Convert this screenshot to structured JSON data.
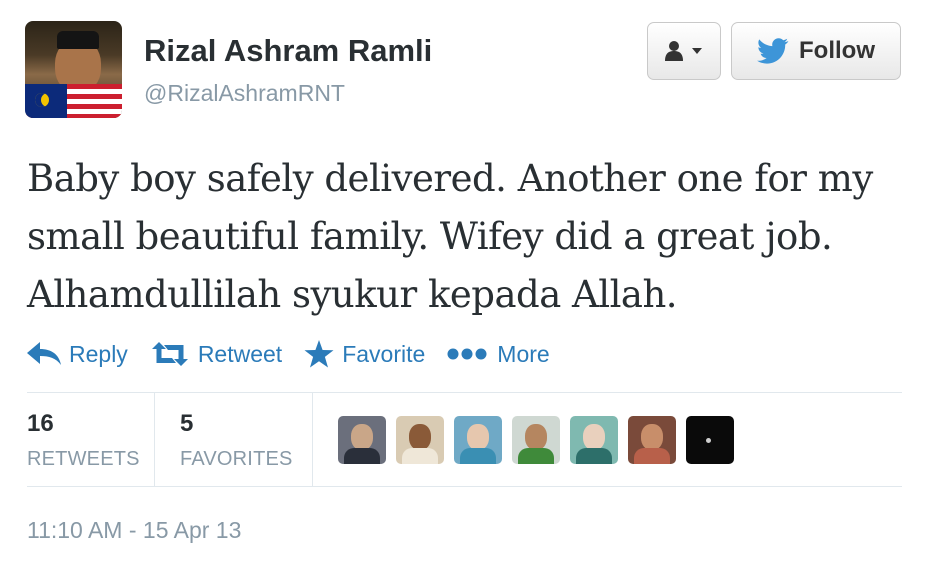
{
  "author": {
    "name": "Rizal Ashram Ramli",
    "handle": "@RizalAshramRNT"
  },
  "buttons": {
    "follow_label": "Follow"
  },
  "tweet": {
    "text": "Baby boy safely delivered. Another one for my small beautiful family. Wifey did a great job. Alhamdullilah syukur kepada Allah."
  },
  "actions": [
    {
      "label": "Reply",
      "icon": "reply-icon"
    },
    {
      "label": "Retweet",
      "icon": "retweet-icon"
    },
    {
      "label": "Favorite",
      "icon": "star-icon"
    },
    {
      "label": "More",
      "icon": "more-dots-icon"
    }
  ],
  "stats": {
    "retweets": {
      "count": "16",
      "label": "RETWEETS"
    },
    "favorites": {
      "count": "5",
      "label": "FAVORITES"
    }
  },
  "favoriters_count_shown": 7,
  "timestamp": "11:10 AM - 15 Apr 13",
  "colors": {
    "link_blue": "#2b7bb9",
    "twitter_bird_blue": "#3d95d8",
    "muted_gray": "#8899a6",
    "text_dark": "#292f33"
  }
}
